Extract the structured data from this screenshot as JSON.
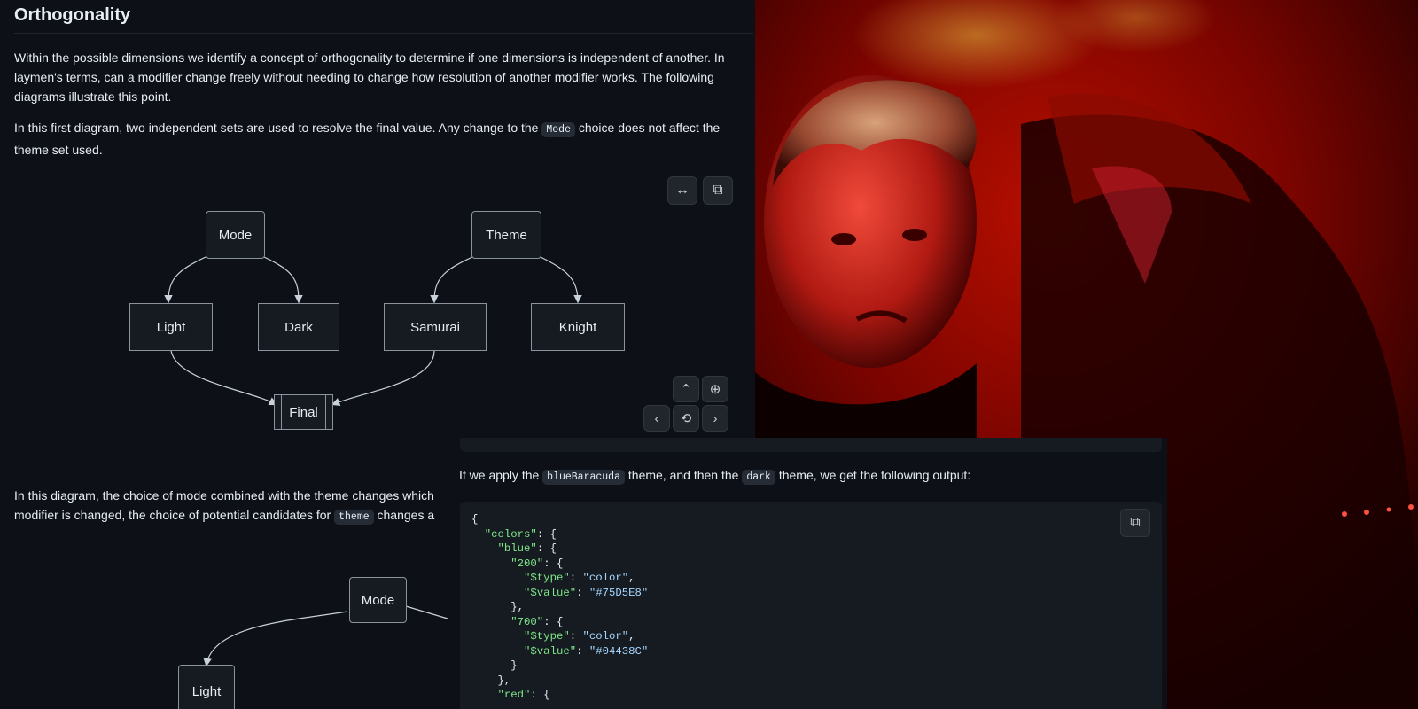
{
  "doc": {
    "heading": "Orthogonality",
    "para1": "Within the possible dimensions we identify a concept of orthogonality to determine if one dimensions is independent of another. In laymen's terms, can a modifier change freely without needing to change how resolution of another modifier works. The following diagrams illustrate this point.",
    "para2_before": "In this first diagram, two independent sets are used to resolve the final value. Any change to the ",
    "para2_code": "Mode",
    "para2_after": " choice does not affect the theme set used.",
    "para3_line1": "In this diagram, the choice of mode combined with the theme changes which",
    "para3_line2_before": "modifier is changed, the choice of potential candidates for ",
    "para3_code": "theme",
    "para3_line2_after": " changes a"
  },
  "diagram1": {
    "nodes": {
      "mode": "Mode",
      "theme": "Theme",
      "light": "Light",
      "dark": "Dark",
      "samurai": "Samurai",
      "knight": "Knight",
      "final": "Final"
    }
  },
  "diagram2": {
    "nodes": {
      "mode": "Mode",
      "light": "Light"
    }
  },
  "controls": {
    "expand_icon": "↔",
    "copy_icon": "⧉",
    "up_icon": "⌃",
    "zoom_icon": "⊕",
    "left_icon": "‹",
    "reset_icon": "⟲",
    "right_icon": "›"
  },
  "overlay": {
    "text_before": "If we apply the ",
    "code1": "blueBaracuda",
    "text_mid": " theme, and then the ",
    "code2": "dark",
    "text_after": " theme, we get the following output:",
    "code_lines": [
      "{",
      "  \"colors\": {",
      "    \"blue\": {",
      "      \"200\": {",
      "        \"$type\": \"color\",",
      "        \"$value\": \"#75D5E8\"",
      "      },",
      "      \"700\": {",
      "        \"$type\": \"color\",",
      "        \"$value\": \"#04438C\"",
      "      }",
      "    },",
      "    \"red\": {"
    ]
  },
  "colors": {
    "accent_green": "#7ee787",
    "accent_blue": "#a5d6ff",
    "bg": "#0d1117"
  }
}
